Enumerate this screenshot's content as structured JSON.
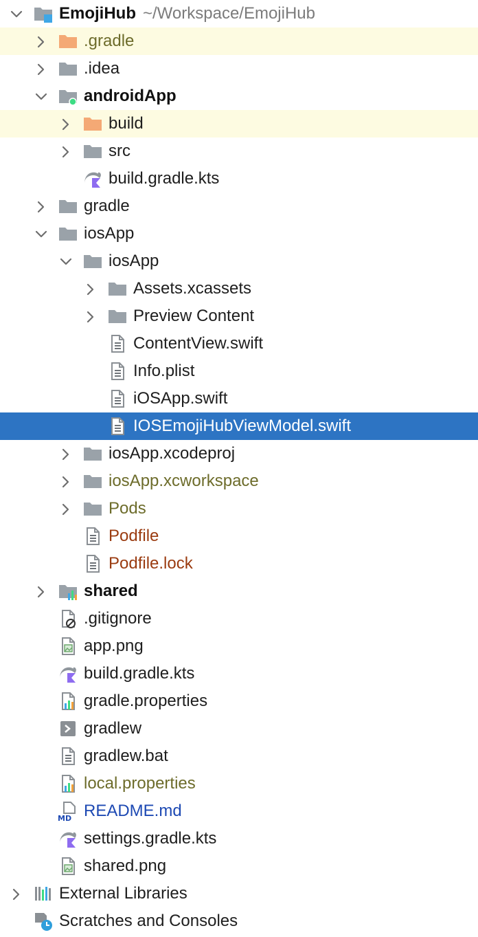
{
  "project": {
    "name": "EmojiHub",
    "path": "~/Workspace/EmojiHub"
  },
  "tree": [
    {
      "label": "EmojiHub",
      "indent": 0,
      "chevron": "down",
      "icon": "module-folder-icon",
      "weight": "bold",
      "hasPath": true
    },
    {
      "label": ".gradle",
      "indent": 1,
      "chevron": "right",
      "icon": "excluded-folder-icon",
      "color": "olive",
      "highlight": true
    },
    {
      "label": ".idea",
      "indent": 1,
      "chevron": "right",
      "icon": "folder-icon"
    },
    {
      "label": "androidApp",
      "indent": 1,
      "chevron": "down",
      "icon": "android-module-folder-icon",
      "weight": "bold"
    },
    {
      "label": "build",
      "indent": 2,
      "chevron": "right",
      "icon": "excluded-folder-icon",
      "highlight": true
    },
    {
      "label": "src",
      "indent": 2,
      "chevron": "right",
      "icon": "folder-icon"
    },
    {
      "label": "build.gradle.kts",
      "indent": 2,
      "icon": "gradle-kotlin-icon"
    },
    {
      "label": "gradle",
      "indent": 1,
      "chevron": "right",
      "icon": "folder-icon"
    },
    {
      "label": "iosApp",
      "indent": 1,
      "chevron": "down",
      "icon": "folder-icon"
    },
    {
      "label": "iosApp",
      "indent": 2,
      "chevron": "down",
      "icon": "folder-icon"
    },
    {
      "label": "Assets.xcassets",
      "indent": 3,
      "chevron": "right",
      "icon": "folder-icon"
    },
    {
      "label": "Preview Content",
      "indent": 3,
      "chevron": "right",
      "icon": "folder-icon"
    },
    {
      "label": "ContentView.swift",
      "indent": 3,
      "icon": "text-file-icon"
    },
    {
      "label": "Info.plist",
      "indent": 3,
      "icon": "text-file-icon"
    },
    {
      "label": "iOSApp.swift",
      "indent": 3,
      "icon": "text-file-icon"
    },
    {
      "label": "IOSEmojiHubViewModel.swift",
      "indent": 3,
      "icon": "text-file-icon",
      "selected": true
    },
    {
      "label": "iosApp.xcodeproj",
      "indent": 2,
      "chevron": "right",
      "icon": "folder-icon"
    },
    {
      "label": "iosApp.xcworkspace",
      "indent": 2,
      "chevron": "right",
      "icon": "folder-icon",
      "color": "olive"
    },
    {
      "label": "Pods",
      "indent": 2,
      "chevron": "right",
      "icon": "folder-icon",
      "color": "olive"
    },
    {
      "label": "Podfile",
      "indent": 2,
      "icon": "text-file-icon",
      "color": "brown"
    },
    {
      "label": "Podfile.lock",
      "indent": 2,
      "icon": "text-file-icon",
      "color": "brown"
    },
    {
      "label": "shared",
      "indent": 1,
      "chevron": "right",
      "icon": "shared-module-folder-icon",
      "weight": "bold"
    },
    {
      "label": ".gitignore",
      "indent": 1,
      "icon": "ignore-file-icon"
    },
    {
      "label": "app.png",
      "indent": 1,
      "icon": "image-file-icon"
    },
    {
      "label": "build.gradle.kts",
      "indent": 1,
      "icon": "gradle-kotlin-icon"
    },
    {
      "label": "gradle.properties",
      "indent": 1,
      "icon": "properties-file-icon"
    },
    {
      "label": "gradlew",
      "indent": 1,
      "icon": "shell-script-icon"
    },
    {
      "label": "gradlew.bat",
      "indent": 1,
      "icon": "text-file-icon"
    },
    {
      "label": "local.properties",
      "indent": 1,
      "icon": "properties-file-icon",
      "color": "olive"
    },
    {
      "label": "README.md",
      "indent": 1,
      "icon": "markdown-file-icon",
      "color": "blue"
    },
    {
      "label": "settings.gradle.kts",
      "indent": 1,
      "icon": "gradle-kotlin-icon"
    },
    {
      "label": "shared.png",
      "indent": 1,
      "icon": "image-file-icon"
    },
    {
      "label": "External Libraries",
      "indent": 0,
      "chevron": "right",
      "icon": "libraries-icon"
    },
    {
      "label": "Scratches and Consoles",
      "indent": 0,
      "icon": "scratches-icon"
    }
  ],
  "colors": {
    "selection": "#2d74c3",
    "highlight_row": "#fdfbe1",
    "excluded_folder": "#f4a975",
    "folder": "#9aa2a9",
    "olive_text": "#6d6c2b",
    "brown_text": "#9a3b10",
    "blue_text": "#1d49b3"
  }
}
